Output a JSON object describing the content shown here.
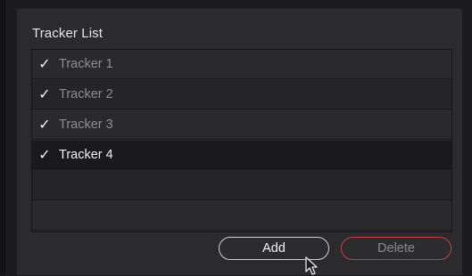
{
  "panel": {
    "title": "Tracker List"
  },
  "trackers": [
    {
      "label": "Tracker 1",
      "checked": true,
      "selected": false,
      "check_glyph": "✓"
    },
    {
      "label": "Tracker 2",
      "checked": true,
      "selected": false,
      "check_glyph": "✓"
    },
    {
      "label": "Tracker 3",
      "checked": true,
      "selected": false,
      "check_glyph": "✓"
    },
    {
      "label": "Tracker 4",
      "checked": true,
      "selected": true,
      "check_glyph": "✓"
    }
  ],
  "buttons": {
    "add_label": "Add",
    "delete_label": "Delete"
  },
  "colors": {
    "delete_border": "#c2413a",
    "selected_row": "#1a1a1c"
  }
}
